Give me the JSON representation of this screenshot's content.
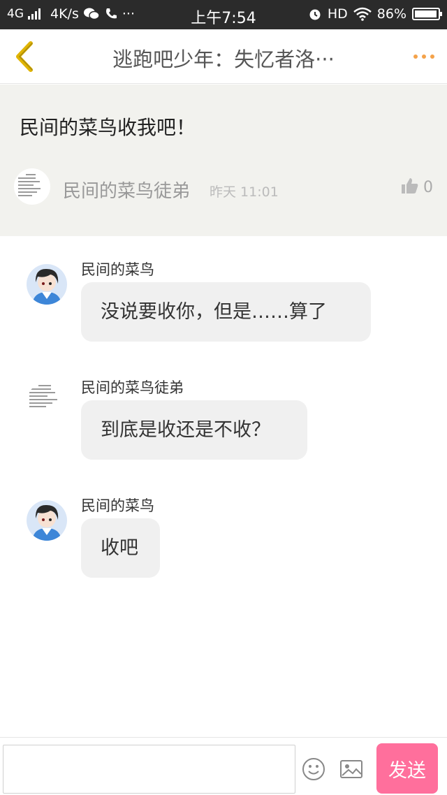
{
  "status_bar": {
    "network": "4G",
    "speed": "4K/s",
    "more": "···",
    "time": "上午7:54",
    "hd": "HD",
    "battery": "86%",
    "battery_level": 0.86
  },
  "nav": {
    "title": "逃跑吧少年：失忆者洛···"
  },
  "topic": {
    "title": "民间的菜鸟收我吧！",
    "poster_name": "民间的菜鸟徒弟",
    "time": "昨天 11:01",
    "like_count": "0"
  },
  "messages": [
    {
      "sender": "民间的菜鸟",
      "text": "没说要收你，但是……算了",
      "avatar": "anime-avatar"
    },
    {
      "sender": "民间的菜鸟徒弟",
      "text": "到底是收还是不收？",
      "avatar": "document-avatar"
    },
    {
      "sender": "民间的菜鸟",
      "text": "收吧",
      "avatar": "anime-avatar"
    }
  ],
  "input": {
    "placeholder": "",
    "send_label": "发送"
  },
  "colors": {
    "accent": "#ff6f9c",
    "more_dots": "#f4a24a",
    "back_arrow": "#e0b400",
    "header_bg": "#f2f2ee",
    "bubble_bg": "#f0f0f0"
  }
}
